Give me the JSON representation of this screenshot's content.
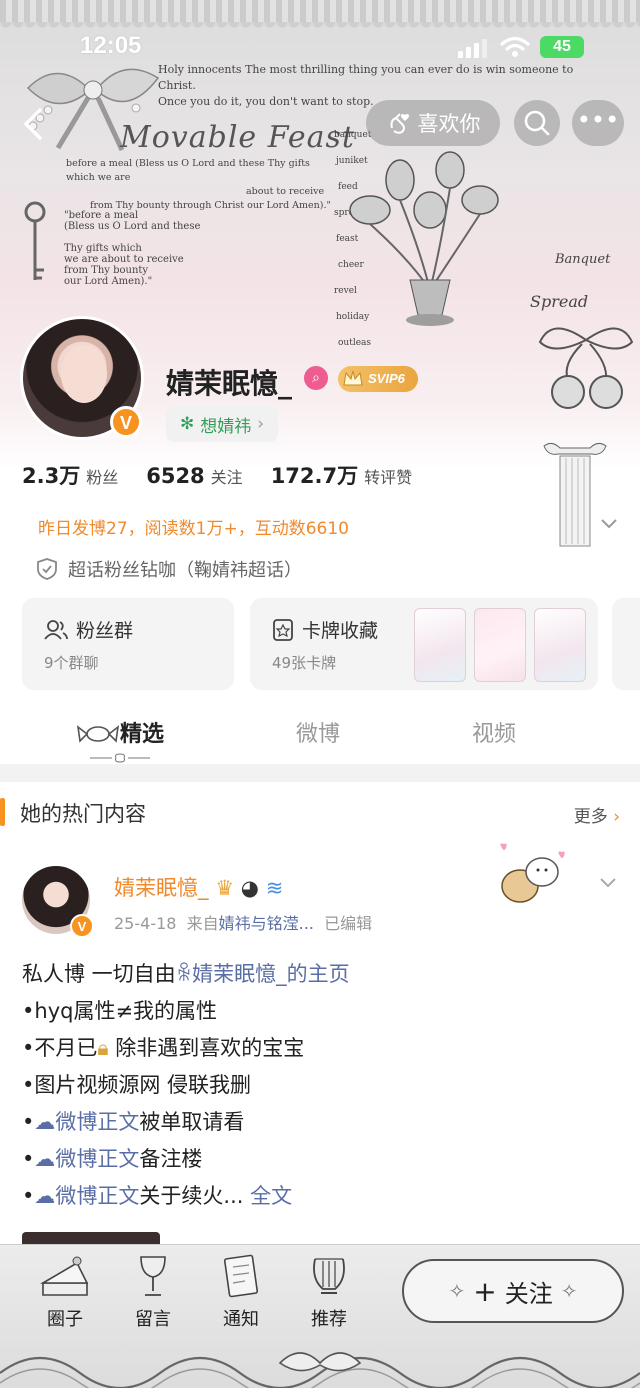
{
  "status_bar": {
    "time": "12:05",
    "battery": "45"
  },
  "banner": {
    "quote_line1": "Holy innocents The most thrilling thing you can ever do is win someone to Christ.",
    "quote_line2": "Once you do it, you don't want to stop.",
    "title": "Movable Feast",
    "prayer_line1": "before a meal (Bless us O Lord and these Thy gifts which we are",
    "prayer_line2": "about to receive",
    "prayer_line3": "from Thy bounty through Christ our Lord Amen).\"",
    "prayer2_line1": "\"before a meal",
    "prayer2_line2": "(Bless us O Lord and these",
    "prayer2_line3": "Thy gifts which",
    "prayer2_line4": "we are about to receive",
    "prayer2_line5": "from Thy bounty",
    "prayer2_line6": "our Lord Amen).\"",
    "words": [
      "banquet",
      "juniket",
      "feed",
      "spread",
      "feast",
      "cheer",
      "revel",
      "holiday",
      "outleas"
    ],
    "banquet_script": "Banquet",
    "spread_script": "Spread"
  },
  "nav": {
    "like_label": "喜欢你"
  },
  "profile": {
    "username": "婧茉眠憶_",
    "vip_label": "SVIP6",
    "fan_tag": "想婧祎",
    "stats": [
      {
        "num": "2.3万",
        "label": "粉丝"
      },
      {
        "num": "6528",
        "label": "关注"
      },
      {
        "num": "172.7万",
        "label": "转评赞"
      }
    ],
    "activity": "昨日发博27，阅读数1万+，互动数6610",
    "chaohua": "超话粉丝钻咖（鞠婧祎超话）"
  },
  "cards": {
    "fans_group": {
      "title": "粉丝群",
      "sub": "9个群聊"
    },
    "card_collection": {
      "title": "卡牌收藏",
      "sub": "49张卡牌"
    }
  },
  "tabs": [
    "精选",
    "微博",
    "视频"
  ],
  "hot": {
    "title": "她的热门内容",
    "more": "更多"
  },
  "post": {
    "name": "婧茉眠憶_",
    "date": "25-4-18",
    "from_prefix": "来自",
    "source": "婧祎与铭滢...",
    "edited": "已编辑",
    "line1_a": "私人博 一切自由",
    "line1_link": "婧茉眠憶_的主页",
    "line2": "•hyq属性≠我的属性",
    "line3_a": "•不月已",
    "line3_b": " 除非遇到喜欢的宝宝",
    "line4": "•图片视频源网  侵联我删",
    "line5_link": "微博正文",
    "line5_b": "被单取请看",
    "line6_link": "微博正文",
    "line6_b": "备注楼",
    "line7_link": "微博正文",
    "line7_b": "关于续火...",
    "full_text": "全文"
  },
  "bottom_nav": {
    "items": [
      "圈子",
      "留言",
      "通知",
      "推荐"
    ],
    "follow": "关注"
  }
}
